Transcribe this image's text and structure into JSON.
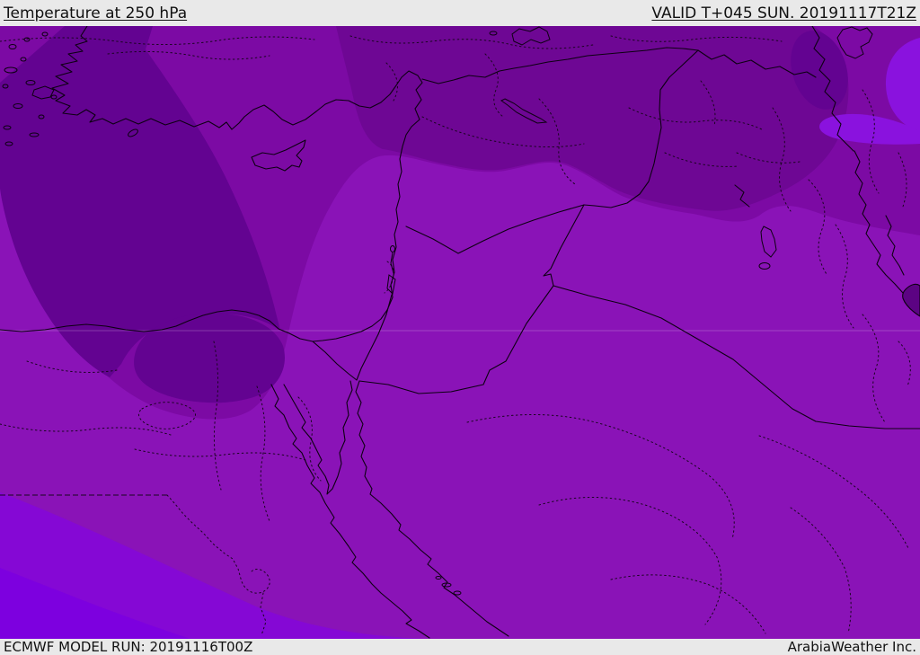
{
  "header": {
    "title": "Temperature at 250 hPa",
    "valid_label": "VALID T+045 SUN. 20191117T21Z"
  },
  "footer": {
    "model_run": "ECMWF MODEL RUN: 20191116T00Z",
    "credit": "ArabiaWeather Inc."
  },
  "map": {
    "type": "weather-contour-map",
    "parameter": "Temperature",
    "pressure_level": "250 hPa",
    "model": "ECMWF",
    "model_run_time": "20191116T00Z",
    "valid_time": "T+045 SUN. 20191117T21Z",
    "colors": {
      "bar_bg": "#e9e9e9",
      "bar_text": "#111111",
      "base": "#8a13b7",
      "intermediate": "#7c0aa4",
      "dark": "#6e0794",
      "darkest": "#630391",
      "bright": "#8508d5",
      "brightest": "#7d00df",
      "bright_east": "#8a12de",
      "water_dark": "#5c0383",
      "line": "#0d0012",
      "gridline": "rgba(255,255,255,0.22)"
    }
  }
}
